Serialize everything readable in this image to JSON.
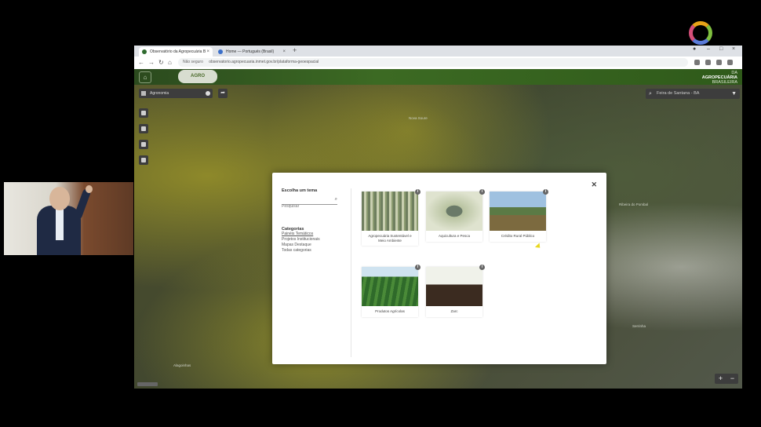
{
  "browser": {
    "tabs": [
      {
        "label": "Observatório da Agropecuária B"
      },
      {
        "label": "Home — Portugués (Brasil)"
      }
    ],
    "new_tab": "+",
    "address": {
      "security": "Não seguro",
      "url": "observatorio.agropecuaria.inmet.gov.br/plataforma-geoespacial"
    }
  },
  "site": {
    "home_icon": "⌂",
    "logo_text": "AGRO",
    "brand_line1": "DA",
    "brand_line2": "AGROPECUÁRIA",
    "brand_line3": "BRASILEIRA"
  },
  "map": {
    "layer_select": "Agronomia",
    "search_placeholder": "Feira de Santana - BA",
    "places": [
      "Nova Soure",
      "Ribeira do Pombal",
      "Feira de Santana",
      "Serrinha",
      "Alagoinhas"
    ]
  },
  "modal": {
    "title": "Escolha um tema",
    "search_placeholder": "Pesquisar",
    "categories_title": "Categorias",
    "categories": [
      "Painéis Temáticos",
      "Projetos Institucionais",
      "Mapas Destaque",
      "Todas categorias"
    ],
    "cards": [
      {
        "label": "Agropecuária Sustentável e Meio Ambiente"
      },
      {
        "label": "Aquicultura e Pesca"
      },
      {
        "label": "Crédito Rural Público"
      },
      {
        "label": "Produtos Agrícolas"
      },
      {
        "label": "Zarc"
      }
    ],
    "info_glyph": "i",
    "close_glyph": "✕"
  }
}
